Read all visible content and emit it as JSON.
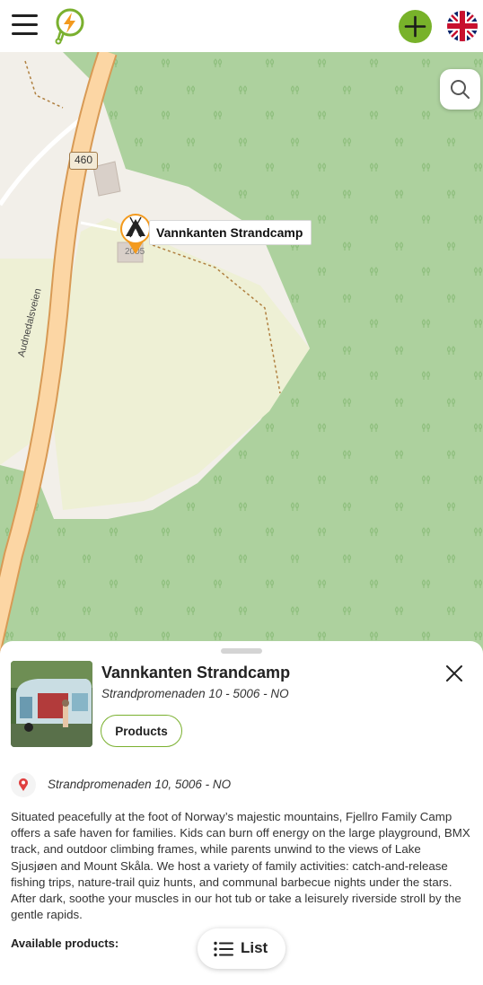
{
  "header": {
    "menu_icon": "hamburger-icon",
    "logo_icon": "plug-lightning-logo",
    "add_icon": "plus-icon",
    "language_flag": "uk-flag-icon",
    "brand_green": "#78b22a"
  },
  "map": {
    "road_number": "460",
    "street_name": "Audnedalsveien",
    "house_number": "2005",
    "marker": {
      "icon": "tent-icon",
      "label": "Vannkanten Strandcamp",
      "color": "#f39a1e"
    },
    "search_icon": "search-icon"
  },
  "detail": {
    "title": "Vannkanten Strandcamp",
    "subtitle_address": "Strandpromenaden 10 - 5006 - NO",
    "products_button": "Products",
    "close_icon": "close-icon",
    "location_icon": "map-pin-icon",
    "address": "Strandpromenaden 10, 5006 - NO",
    "description": "Situated peacefully at the foot of Norway’s majestic mountains, Fjellro Family Camp offers a safe haven for families. Kids can burn off energy on the large playground, BMX track, and outdoor climbing frames, while parents unwind to the views of Lake Sjusjøen and Mount Skåla. We host a variety of family activities: catch-and-release fishing trips, nature-trail quiz hunts, and communal barbecue nights under the stars. After dark, soothe your muscles in our hot tub or take a leisurely riverside stroll by the gentle rapids.",
    "available_products_label": "Available products:",
    "list_button": "List",
    "list_icon": "list-icon"
  }
}
